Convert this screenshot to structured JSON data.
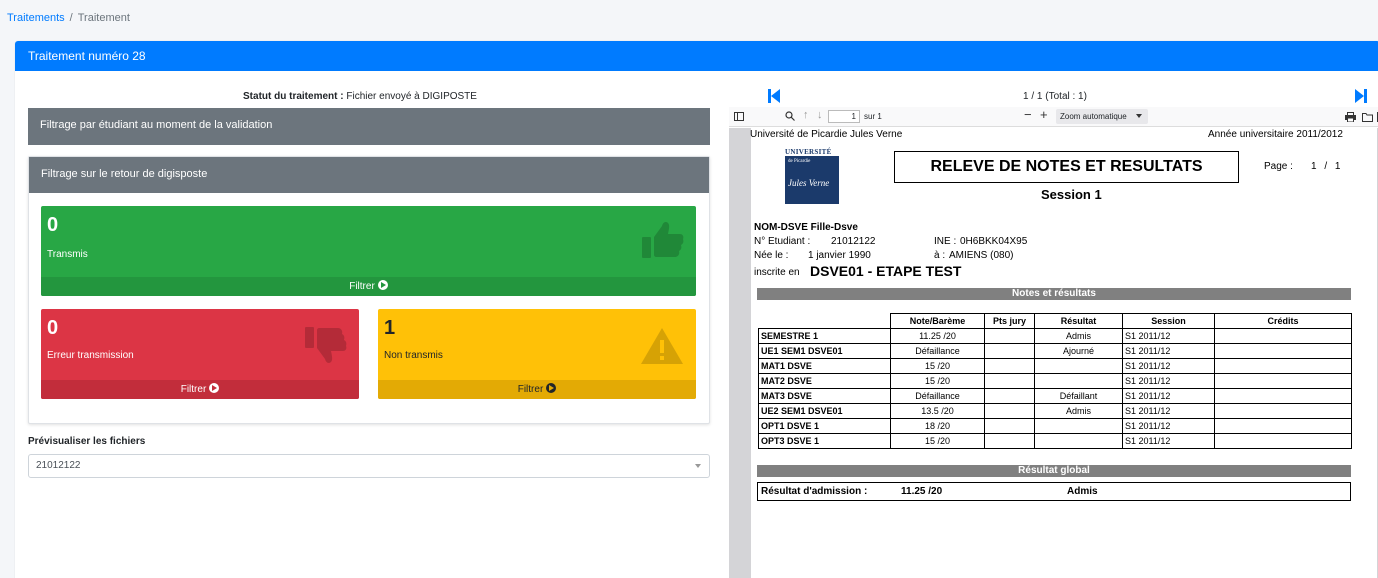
{
  "breadcrumb": {
    "parent": "Traitements",
    "separator": "/",
    "current": "Traitement"
  },
  "card": {
    "title": "Traitement numéro 28"
  },
  "status": {
    "label": "Statut du traitement :",
    "value": "Fichier envoyé à DIGIPOSTE"
  },
  "filters": {
    "validation_title": "Filtrage par étudiant au moment de la validation",
    "digiposte_title": "Filtrage sur le retour de digisposte",
    "transmis": {
      "count": "0",
      "label": "Transmis",
      "button": "Filtrer",
      "color": "#28a745",
      "icon": "thumbs-up-icon"
    },
    "erreur": {
      "count": "0",
      "label": "Erreur transmission",
      "button": "Filtrer",
      "color": "#dc3545",
      "icon": "thumbs-down-icon"
    },
    "non_transmis": {
      "count": "1",
      "label": "Non transmis",
      "button": "Filtrer",
      "color": "#ffc107",
      "icon": "warning-icon"
    }
  },
  "preview": {
    "label": "Prévisualiser les fichiers",
    "selected": "21012122"
  },
  "pdf_nav": {
    "pages": "1 / 1 (Total : 1)"
  },
  "pdf_toolbar": {
    "page_input": "1",
    "page_of": "sur 1",
    "zoom": "Zoom automatique"
  },
  "document": {
    "university": "Université de Picardie Jules Verne",
    "year": "Année universitaire 2011/2012",
    "logo_text": "UNIVERSITÉ de Picardie Jules Verne",
    "title": "RELEVE DE NOTES ET RESULTATS",
    "session": "Session 1",
    "page_label": "Page :",
    "page_value": "1 / 1",
    "student_name": "NOM-DSVE Fille-Dsve",
    "student_number_label": "N° Etudiant :",
    "student_number": "21012122",
    "ine_label": "INE :",
    "ine": "0H6BKK04X95",
    "born_label": "Née le :",
    "born": "1 janvier 1990",
    "at_label": "à :",
    "at": "AMIENS (080)",
    "enrolled_label": "inscrite en",
    "enrolled": "DSVE01 - ETAPE TEST",
    "notes_header": "Notes et résultats",
    "columns": [
      "",
      "Note/Barème",
      "Pts jury",
      "Résultat",
      "Session",
      "Crédits"
    ],
    "rows": [
      [
        "SEMESTRE 1",
        "11.25 /20",
        "",
        "Admis",
        "S1 2011/12",
        ""
      ],
      [
        "UE1 SEM1 DSVE01",
        "Défaillance",
        "",
        "Ajourné",
        "S1 2011/12",
        ""
      ],
      [
        "MAT1 DSVE",
        "15 /20",
        "",
        "",
        "S1 2011/12",
        ""
      ],
      [
        "MAT2 DSVE",
        "15 /20",
        "",
        "",
        "S1 2011/12",
        ""
      ],
      [
        "MAT3 DSVE",
        "Défaillance",
        "",
        "Défaillant",
        "S1 2011/12",
        ""
      ],
      [
        "UE2 SEM1 DSVE01",
        "13.5 /20",
        "",
        "Admis",
        "S1 2011/12",
        ""
      ],
      [
        "OPT1 DSVE 1",
        "18 /20",
        "",
        "",
        "S1 2011/12",
        ""
      ],
      [
        "OPT3 DSVE 1",
        "15 /20",
        "",
        "",
        "S1 2011/12",
        ""
      ]
    ],
    "global_header": "Résultat global",
    "admission_label": "Résultat d'admission :",
    "admission_note": "11.25 /20",
    "admission_result": "Admis"
  }
}
